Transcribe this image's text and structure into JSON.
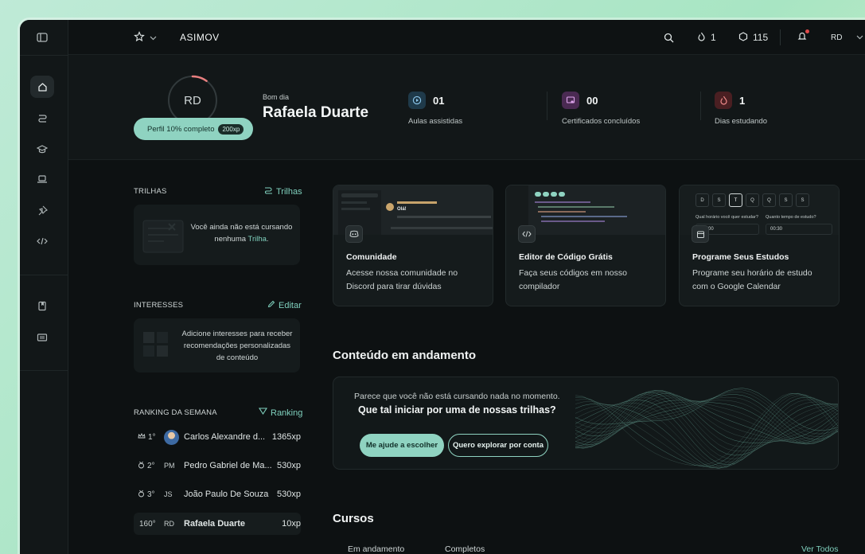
{
  "app": {
    "name": "ASIMOV",
    "accent": "#8fd3c1"
  },
  "topbar": {
    "lives": "1",
    "coins": "115",
    "user_initials": "RD"
  },
  "profile": {
    "initials": "RD",
    "completion_label": "Perfil 10% completo",
    "completion_xp": "200xp",
    "completion_fraction": 0.1,
    "greeting": "Bom dia",
    "name": "Rafaela Duarte"
  },
  "stats": [
    {
      "value": "01",
      "label": "Aulas assistidas",
      "icon": "play-icon",
      "color": "#1f3a4a"
    },
    {
      "value": "00",
      "label": "Certificados concluídos",
      "icon": "certificate-icon",
      "color": "#4a2a52"
    },
    {
      "value": "1",
      "label": "Dias estudando",
      "icon": "fire-icon",
      "color": "#4a1f22"
    }
  ],
  "trilhas": {
    "title": "TRILHAS",
    "link": "Trilhas",
    "empty_line1": "Você ainda não está cursando",
    "empty_line2_prefix": "nenhuma ",
    "empty_highlight": "Trilha",
    "empty_suffix": "."
  },
  "interesses": {
    "title": "INTERESSES",
    "link": "Editar",
    "line1": "Adicione interesses para receber",
    "line2": "recomendações personalizadas",
    "line3": "de conteúdo"
  },
  "ranking": {
    "title": "RANKING DA SEMANA",
    "link": "Ranking",
    "rows": [
      {
        "pos": "1°",
        "initials": "",
        "name": "Carlos Alexandre d...",
        "xp": "1365xp"
      },
      {
        "pos": "2°",
        "initials": "PM",
        "name": "Pedro Gabriel de Ma...",
        "xp": "530xp"
      },
      {
        "pos": "3°",
        "initials": "JS",
        "name": "João Paulo De Souza",
        "xp": "530xp"
      },
      {
        "pos": "160°",
        "initials": "RD",
        "name": "Rafaela Duarte",
        "xp": "10xp"
      }
    ]
  },
  "cards": [
    {
      "title": "Comunidade",
      "desc": "Acesse nossa comunidade no Discord para tirar dúvidas",
      "preview_greeting": "Olá!"
    },
    {
      "title": "Editor de Código Grátis",
      "desc": "Faça seus códigos em nosso compilador"
    },
    {
      "title": "Programe Seus Estudos",
      "desc": "Programe seu horário de estudo com o Google Calendar",
      "days": [
        "D",
        "S",
        "T",
        "Q",
        "Q",
        "S",
        "S"
      ],
      "q_time": "Qual horário você quer estudar?",
      "q_duration": "Quanto tempo de estudo?",
      "time_value": "00",
      "duration_value": "00:30"
    }
  ],
  "progress": {
    "title": "Conteúdo em andamento",
    "line1": "Parece que você não está cursando nada no momento.",
    "line2": "Que tal iniciar por uma de nossas trilhas?",
    "btn_primary": "Me ajude a escolher",
    "btn_secondary": "Quero explorar por conta"
  },
  "courses": {
    "title": "Cursos",
    "tabs": [
      "Em andamento",
      "Completos"
    ],
    "see_all": "Ver Todos"
  }
}
